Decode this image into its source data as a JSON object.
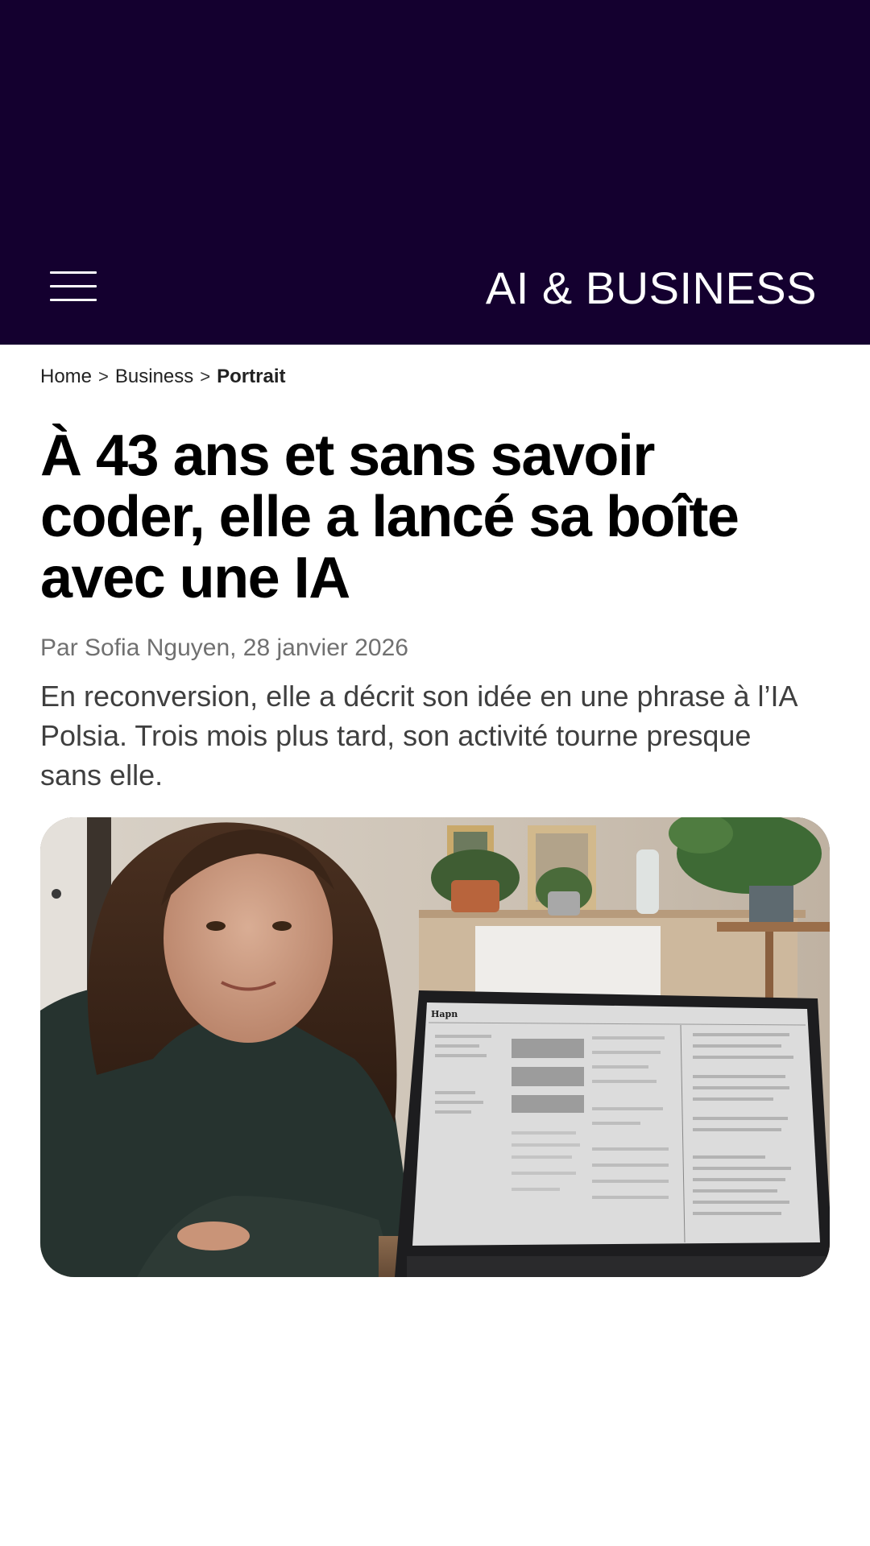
{
  "header": {
    "brand": "AI & BUSINESS",
    "background_color": "#14002f",
    "menu_icon": "hamburger-menu-icon"
  },
  "breadcrumb": {
    "items": [
      "Home",
      "Business"
    ],
    "current": "Portrait",
    "separator": ">"
  },
  "article": {
    "title": "À 43 ans et sans savoir coder, elle a lancé sa boîte avec une IA",
    "byline": "Par Sofia Nguyen, 28 janvier 2026",
    "dek": "En reconversion, elle a décrit son idée en une phrase à l’IA Polsia. Trois mois plus tard, son activité tourne presque sans elle.",
    "hero_image": {
      "screen_app_name": "Hapn"
    }
  }
}
